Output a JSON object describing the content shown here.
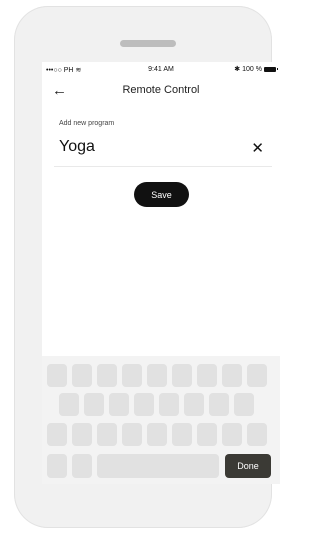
{
  "status_bar": {
    "carrier": "•••○○ PH",
    "time": "9:41 AM",
    "bluetooth": "✱",
    "battery_text": "100 %"
  },
  "nav": {
    "back_icon": "←",
    "title": "Remote Control"
  },
  "form": {
    "field_label": "Add new program",
    "input_value": "Yoga",
    "clear_icon": "✕",
    "save_label": "Save"
  },
  "keyboard": {
    "done_label": "Done"
  },
  "icons": {
    "wifi": "wifi-icon",
    "back": "back-arrow-icon",
    "clear": "close-icon",
    "battery": "battery-icon"
  }
}
